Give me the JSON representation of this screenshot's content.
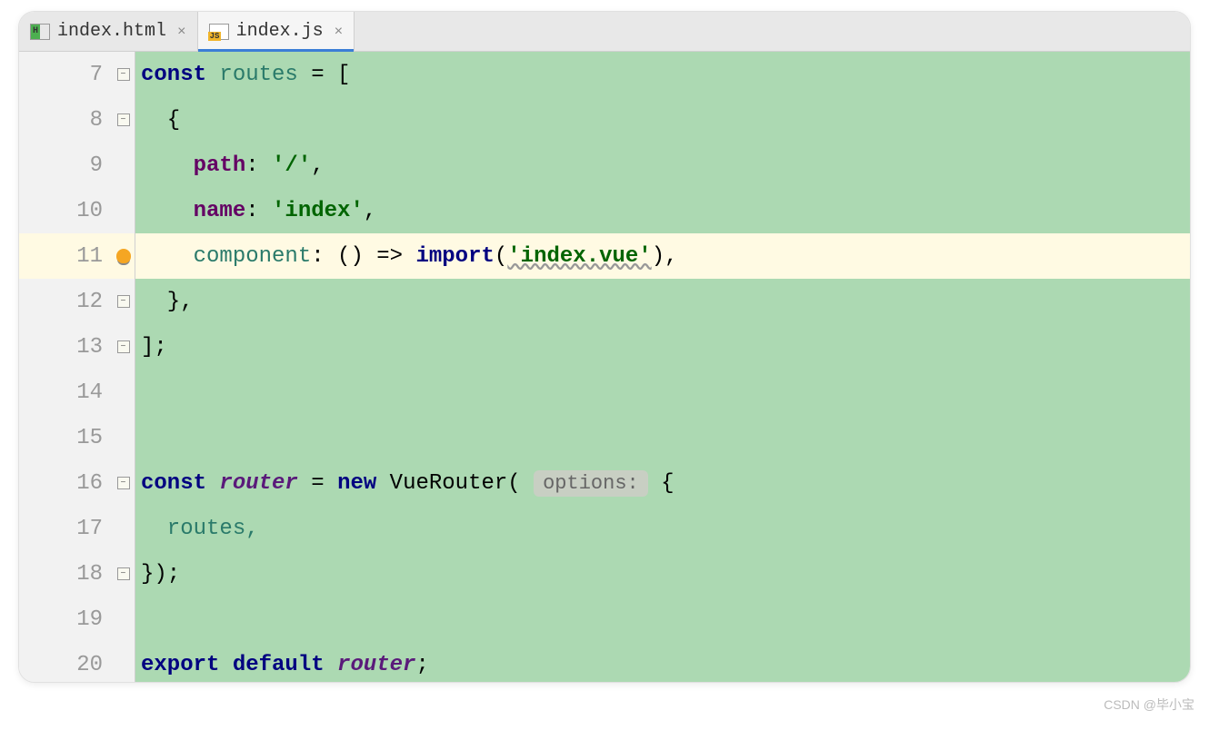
{
  "tabs": [
    {
      "label": "index.html",
      "active": false,
      "icon": "html"
    },
    {
      "label": "index.js",
      "active": true,
      "icon": "js"
    }
  ],
  "gutter_start": 7,
  "highlighted_line": 11,
  "code_lines": [
    {
      "n": 7,
      "fold": "open",
      "tokens": [
        {
          "t": "const ",
          "c": "kw"
        },
        {
          "t": "routes ",
          "c": "ident"
        },
        {
          "t": "= [",
          "c": "plain"
        }
      ]
    },
    {
      "n": 8,
      "fold": "open",
      "tokens": [
        {
          "t": "  {",
          "c": "plain"
        }
      ]
    },
    {
      "n": 9,
      "fold": "",
      "tokens": [
        {
          "t": "    ",
          "c": "plain"
        },
        {
          "t": "path",
          "c": "prop"
        },
        {
          "t": ": ",
          "c": "plain"
        },
        {
          "t": "'/'",
          "c": "str"
        },
        {
          "t": ",",
          "c": "plain"
        }
      ]
    },
    {
      "n": 10,
      "fold": "",
      "tokens": [
        {
          "t": "    ",
          "c": "plain"
        },
        {
          "t": "name",
          "c": "prop"
        },
        {
          "t": ": ",
          "c": "plain"
        },
        {
          "t": "'index'",
          "c": "str"
        },
        {
          "t": ",",
          "c": "plain"
        }
      ]
    },
    {
      "n": 11,
      "fold": "bulb",
      "tokens": [
        {
          "t": "    ",
          "c": "plain"
        },
        {
          "t": "component",
          "c": "ident"
        },
        {
          "t": ": () => ",
          "c": "plain"
        },
        {
          "t": "import",
          "c": "kw"
        },
        {
          "t": "(",
          "c": "plain"
        },
        {
          "t": "'index.vue'",
          "c": "str-u"
        },
        {
          "t": "),",
          "c": "plain"
        }
      ]
    },
    {
      "n": 12,
      "fold": "close",
      "tokens": [
        {
          "t": "  },",
          "c": "plain"
        }
      ]
    },
    {
      "n": 13,
      "fold": "close",
      "tokens": [
        {
          "t": "];",
          "c": "plain"
        }
      ]
    },
    {
      "n": 14,
      "fold": "",
      "tokens": []
    },
    {
      "n": 15,
      "fold": "",
      "tokens": []
    },
    {
      "n": 16,
      "fold": "open",
      "tokens": [
        {
          "t": "const ",
          "c": "kw"
        },
        {
          "t": "router",
          "c": "ident-italic"
        },
        {
          "t": " = ",
          "c": "plain"
        },
        {
          "t": "new ",
          "c": "kw"
        },
        {
          "t": "VueRouter",
          "c": "plain"
        },
        {
          "t": "( ",
          "c": "plain"
        },
        {
          "t": "options:",
          "c": "hint"
        },
        {
          "t": " {",
          "c": "plain"
        }
      ]
    },
    {
      "n": 17,
      "fold": "",
      "tokens": [
        {
          "t": "  routes,",
          "c": "ident"
        }
      ]
    },
    {
      "n": 18,
      "fold": "close",
      "tokens": [
        {
          "t": "});",
          "c": "plain"
        }
      ]
    },
    {
      "n": 19,
      "fold": "",
      "tokens": []
    },
    {
      "n": 20,
      "fold": "",
      "tokens": [
        {
          "t": "export default ",
          "c": "kw"
        },
        {
          "t": "router",
          "c": "ident-italic"
        },
        {
          "t": ";",
          "c": "plain"
        }
      ]
    }
  ],
  "watermark": "CSDN @毕小宝"
}
